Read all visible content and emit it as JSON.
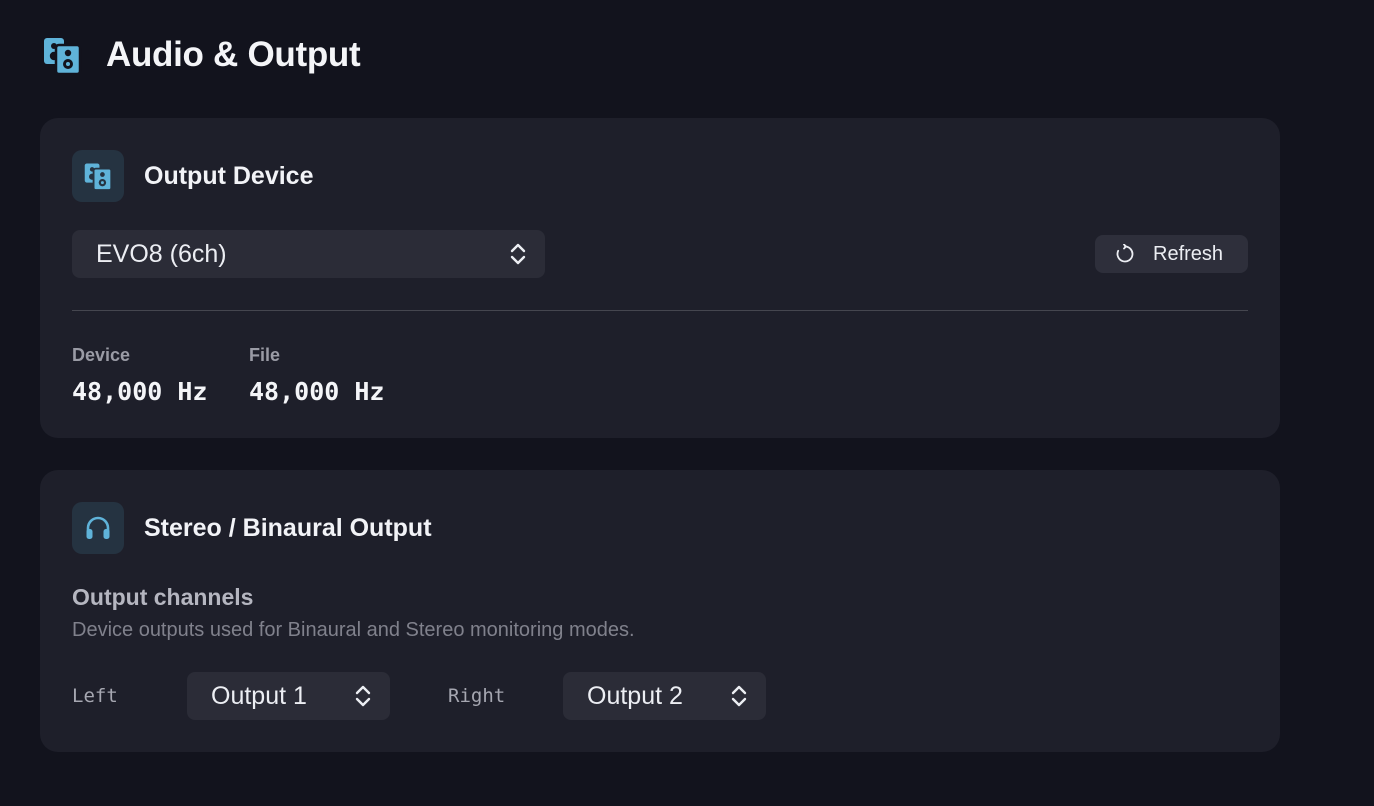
{
  "page": {
    "title": "Audio & Output",
    "title_icon": "speaker-icon"
  },
  "output_device": {
    "title": "Output Device",
    "icon": "speaker-icon",
    "selected_device": "EVO8 (6ch)",
    "refresh_label": "Refresh",
    "device_rate_label": "Device",
    "device_rate_value": "48,000 Hz",
    "file_rate_label": "File",
    "file_rate_value": "48,000 Hz"
  },
  "stereo_output": {
    "title": "Stereo / Binaural Output",
    "icon": "headphones-icon",
    "channels_label": "Output channels",
    "channels_description": "Device outputs used for Binaural and Stereo monitoring modes.",
    "left_label": "Left",
    "left_value": "Output 1",
    "right_label": "Right",
    "right_value": "Output 2"
  },
  "colors": {
    "background": "#12131d",
    "card": "#1e1f2a",
    "accent": "#5fb3d9",
    "control": "#2b2c37"
  }
}
